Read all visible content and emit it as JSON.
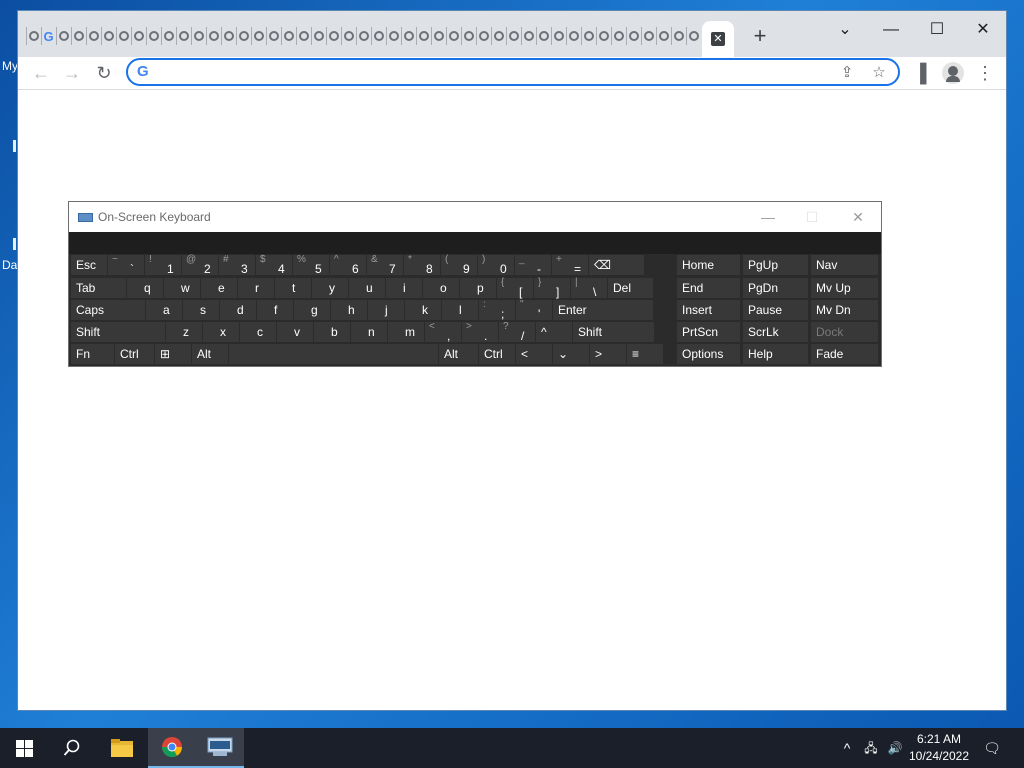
{
  "desktop": {
    "fragments": [
      "My",
      "Da"
    ]
  },
  "chrome": {
    "tabs_count": 45,
    "new_tab_label": "+",
    "window_controls": {
      "dropdown": "⌄",
      "minimize": "—",
      "maximize": "☐",
      "close": "✕"
    },
    "toolbar": {
      "back": "←",
      "forward": "→",
      "reload": "↻"
    },
    "omnibox": {
      "g_logo": "G",
      "placeholder": "",
      "value": ""
    },
    "omnibox_icons": {
      "share": "⇪",
      "bookmark": "☆"
    },
    "side_panel_icon": "▐",
    "menu_icon": "⋮"
  },
  "osk": {
    "title": "On-Screen Keyboard",
    "controls": {
      "minimize": "—",
      "maximize": "☐",
      "close": "✕"
    },
    "rows": [
      [
        {
          "label": "Esc"
        },
        {
          "shift": "~",
          "main": "`"
        },
        {
          "shift": "!",
          "main": "1"
        },
        {
          "shift": "@",
          "main": "2"
        },
        {
          "shift": "#",
          "main": "3"
        },
        {
          "shift": "$",
          "main": "4"
        },
        {
          "shift": "%",
          "main": "5"
        },
        {
          "shift": "^",
          "main": "6"
        },
        {
          "shift": "&",
          "main": "7"
        },
        {
          "shift": "*",
          "main": "8"
        },
        {
          "shift": "(",
          "main": "9"
        },
        {
          "shift": ")",
          "main": "0"
        },
        {
          "shift": "_",
          "main": "-"
        },
        {
          "shift": "+",
          "main": "="
        },
        {
          "label": "⌫"
        }
      ],
      [
        {
          "label": "Tab"
        },
        {
          "label": "q"
        },
        {
          "label": "w"
        },
        {
          "label": "e"
        },
        {
          "label": "r"
        },
        {
          "label": "t"
        },
        {
          "label": "y"
        },
        {
          "label": "u"
        },
        {
          "label": "i"
        },
        {
          "label": "o"
        },
        {
          "label": "p"
        },
        {
          "shift": "{",
          "main": "["
        },
        {
          "shift": "}",
          "main": "]"
        },
        {
          "shift": "|",
          "main": "\\"
        },
        {
          "label": "Del"
        }
      ],
      [
        {
          "label": "Caps"
        },
        {
          "label": "a"
        },
        {
          "label": "s"
        },
        {
          "label": "d"
        },
        {
          "label": "f"
        },
        {
          "label": "g"
        },
        {
          "label": "h"
        },
        {
          "label": "j"
        },
        {
          "label": "k"
        },
        {
          "label": "l"
        },
        {
          "shift": ":",
          "main": ";"
        },
        {
          "shift": "\"",
          "main": "'"
        },
        {
          "label": "Enter"
        }
      ],
      [
        {
          "label": "Shift"
        },
        {
          "label": "z"
        },
        {
          "label": "x"
        },
        {
          "label": "c"
        },
        {
          "label": "v"
        },
        {
          "label": "b"
        },
        {
          "label": "n"
        },
        {
          "label": "m"
        },
        {
          "shift": "<",
          "main": ","
        },
        {
          "shift": ">",
          "main": "."
        },
        {
          "shift": "?",
          "main": "/"
        },
        {
          "label": "^"
        },
        {
          "label": "Shift"
        }
      ],
      [
        {
          "label": "Fn"
        },
        {
          "label": "Ctrl"
        },
        {
          "label": "⊞"
        },
        {
          "label": "Alt"
        },
        {
          "label": ""
        },
        {
          "label": "Alt"
        },
        {
          "label": "Ctrl"
        },
        {
          "label": "<"
        },
        {
          "label": "⌄"
        },
        {
          "label": ">"
        },
        {
          "label": "≡"
        }
      ]
    ],
    "nav_keys": [
      [
        "Home",
        "PgUp",
        "Nav"
      ],
      [
        "End",
        "PgDn",
        "Mv Up"
      ],
      [
        "Insert",
        "Pause",
        "Mv Dn"
      ],
      [
        "PrtScn",
        "ScrLk",
        "Dock"
      ],
      [
        "Options",
        "Help",
        "Fade"
      ]
    ]
  },
  "taskbar": {
    "start_icon": "windows-logo",
    "search_icon": "search",
    "apps": [
      "file-explorer",
      "chrome",
      "on-screen-keyboard"
    ],
    "tray": {
      "chevron": "^",
      "network": "🖧",
      "volume": "🔊",
      "notifications": "🗨"
    },
    "time": "6:21 AM",
    "date": "10/24/2022"
  }
}
